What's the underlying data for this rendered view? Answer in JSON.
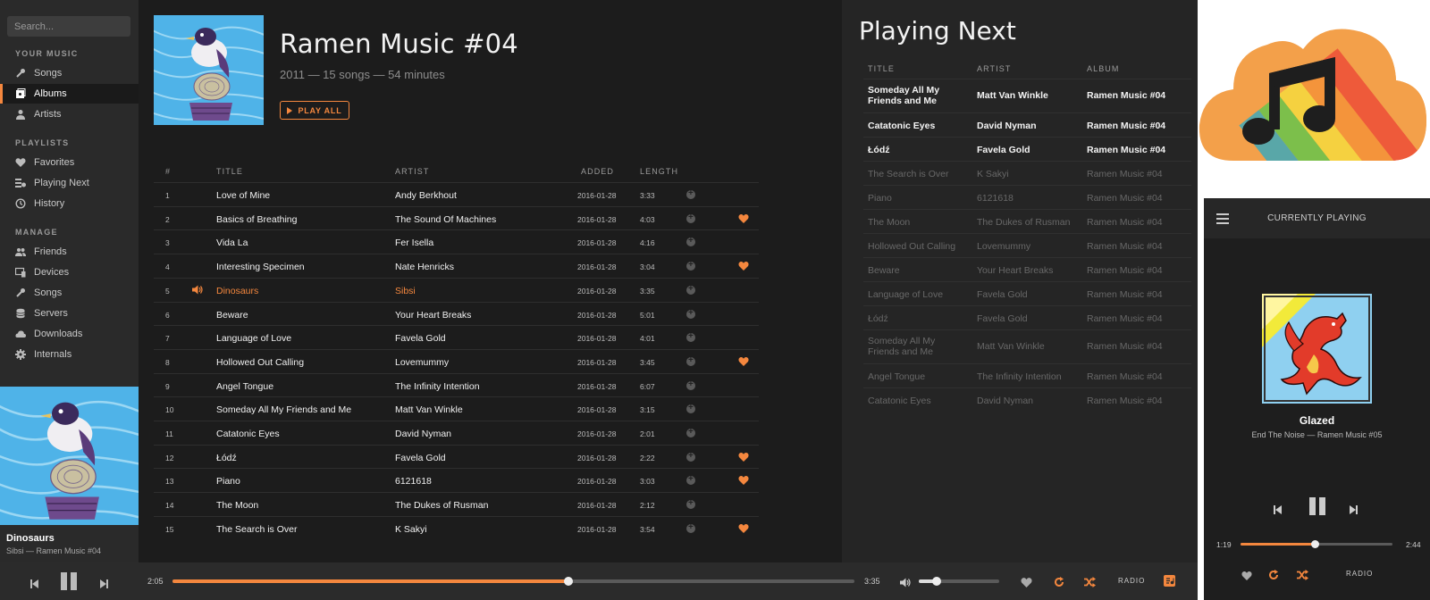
{
  "sidebar": {
    "search_placeholder": "Search...",
    "sections": {
      "your_music": "YOUR MUSIC",
      "playlists": "PLAYLISTS",
      "manage": "MANAGE"
    },
    "items": {
      "songs": "Songs",
      "albums": "Albums",
      "artists": "Artists",
      "favorites": "Favorites",
      "playing_next": "Playing Next",
      "history": "History",
      "friends": "Friends",
      "devices": "Devices",
      "manage_songs": "Songs",
      "servers": "Servers",
      "downloads": "Downloads",
      "internals": "Internals"
    },
    "now_playing": {
      "title": "Dinosaurs",
      "subtitle": "Sibsi — Ramen Music #04"
    }
  },
  "album": {
    "title": "Ramen Music #04",
    "meta": "2011 — 15 songs — 54 minutes",
    "play_all_label": "PLAY ALL",
    "columns": {
      "num": "#",
      "title": "TITLE",
      "artist": "ARTIST",
      "added": "ADDED",
      "length": "LENGTH"
    },
    "tracks": [
      {
        "num": "1",
        "title": "Love of Mine",
        "artist": "Andy Berkhout",
        "added": "2016-01-28",
        "length": "3:33",
        "fav": false,
        "playing": false
      },
      {
        "num": "2",
        "title": "Basics of Breathing",
        "artist": "The Sound Of Machines",
        "added": "2016-01-28",
        "length": "4:03",
        "fav": true,
        "playing": false
      },
      {
        "num": "3",
        "title": "Vida La",
        "artist": "Fer Isella",
        "added": "2016-01-28",
        "length": "4:16",
        "fav": false,
        "playing": false
      },
      {
        "num": "4",
        "title": "Interesting Specimen",
        "artist": "Nate Henricks",
        "added": "2016-01-28",
        "length": "3:04",
        "fav": true,
        "playing": false
      },
      {
        "num": "5",
        "title": "Dinosaurs",
        "artist": "Sibsi",
        "added": "2016-01-28",
        "length": "3:35",
        "fav": false,
        "playing": true
      },
      {
        "num": "6",
        "title": "Beware",
        "artist": "Your Heart Breaks",
        "added": "2016-01-28",
        "length": "5:01",
        "fav": false,
        "playing": false
      },
      {
        "num": "7",
        "title": "Language of Love",
        "artist": "Favela Gold",
        "added": "2016-01-28",
        "length": "4:01",
        "fav": false,
        "playing": false
      },
      {
        "num": "8",
        "title": "Hollowed Out Calling",
        "artist": "Lovemummy",
        "added": "2016-01-28",
        "length": "3:45",
        "fav": true,
        "playing": false
      },
      {
        "num": "9",
        "title": "Angel Tongue",
        "artist": "The Infinity Intention",
        "added": "2016-01-28",
        "length": "6:07",
        "fav": false,
        "playing": false
      },
      {
        "num": "10",
        "title": "Someday All My Friends and Me",
        "artist": "Matt Van Winkle",
        "added": "2016-01-28",
        "length": "3:15",
        "fav": false,
        "playing": false
      },
      {
        "num": "11",
        "title": "Catatonic Eyes",
        "artist": "David Nyman",
        "added": "2016-01-28",
        "length": "2:01",
        "fav": false,
        "playing": false
      },
      {
        "num": "12",
        "title": "Łódź",
        "artist": "Favela Gold",
        "added": "2016-01-28",
        "length": "2:22",
        "fav": true,
        "playing": false
      },
      {
        "num": "13",
        "title": "Piano",
        "artist": "6121618",
        "added": "2016-01-28",
        "length": "3:03",
        "fav": true,
        "playing": false
      },
      {
        "num": "14",
        "title": "The Moon",
        "artist": "The Dukes of Rusman",
        "added": "2016-01-28",
        "length": "2:12",
        "fav": false,
        "playing": false
      },
      {
        "num": "15",
        "title": "The Search is Over",
        "artist": "K Sakyi",
        "added": "2016-01-28",
        "length": "3:54",
        "fav": true,
        "playing": false
      }
    ]
  },
  "queue": {
    "title": "Playing Next",
    "columns": {
      "title": "TITLE",
      "artist": "ARTIST",
      "album": "ALBUM"
    },
    "rows": [
      {
        "title": "Someday All My Friends and Me",
        "artist": "Matt Van Winkle",
        "album": "Ramen Music #04",
        "highlight": true,
        "tall": true
      },
      {
        "title": "Catatonic Eyes",
        "artist": "David Nyman",
        "album": "Ramen Music #04",
        "highlight": true,
        "tall": false
      },
      {
        "title": "Łódź",
        "artist": "Favela Gold",
        "album": "Ramen Music #04",
        "highlight": true,
        "tall": false
      },
      {
        "title": "The Search is Over",
        "artist": "K Sakyi",
        "album": "Ramen Music #04",
        "highlight": false,
        "tall": false
      },
      {
        "title": "Piano",
        "artist": "6121618",
        "album": "Ramen Music #04",
        "highlight": false,
        "tall": false
      },
      {
        "title": "The Moon",
        "artist": "The Dukes of Rusman",
        "album": "Ramen Music #04",
        "highlight": false,
        "tall": false
      },
      {
        "title": "Hollowed Out Calling",
        "artist": "Lovemummy",
        "album": "Ramen Music #04",
        "highlight": false,
        "tall": false
      },
      {
        "title": "Beware",
        "artist": "Your Heart Breaks",
        "album": "Ramen Music #04",
        "highlight": false,
        "tall": false
      },
      {
        "title": "Language of Love",
        "artist": "Favela Gold",
        "album": "Ramen Music #04",
        "highlight": false,
        "tall": false
      },
      {
        "title": "Łódź",
        "artist": "Favela Gold",
        "album": "Ramen Music #04",
        "highlight": false,
        "tall": false
      },
      {
        "title": "Someday All My Friends and Me",
        "artist": "Matt Van Winkle",
        "album": "Ramen Music #04",
        "highlight": false,
        "tall": true
      },
      {
        "title": "Angel Tongue",
        "artist": "The Infinity Intention",
        "album": "Ramen Music #04",
        "highlight": false,
        "tall": false
      },
      {
        "title": "Catatonic Eyes",
        "artist": "David Nyman",
        "album": "Ramen Music #04",
        "highlight": false,
        "tall": false
      }
    ]
  },
  "player": {
    "elapsed": "2:05",
    "total": "3:35",
    "progress": 0.58,
    "volume": 0.22,
    "radio_label": "RADIO"
  },
  "mobile": {
    "header": "CURRENTLY PLAYING",
    "title": "Glazed",
    "subtitle": "End The Noise — Ramen Music #05",
    "elapsed": "1:19",
    "total": "2:44",
    "progress": 0.49,
    "radio_label": "RADIO"
  },
  "colors": {
    "accent": "#f4873e",
    "sidebar_bg": "#2a2a2a",
    "main_bg": "#1c1c1c",
    "queue_bg": "#252525"
  }
}
